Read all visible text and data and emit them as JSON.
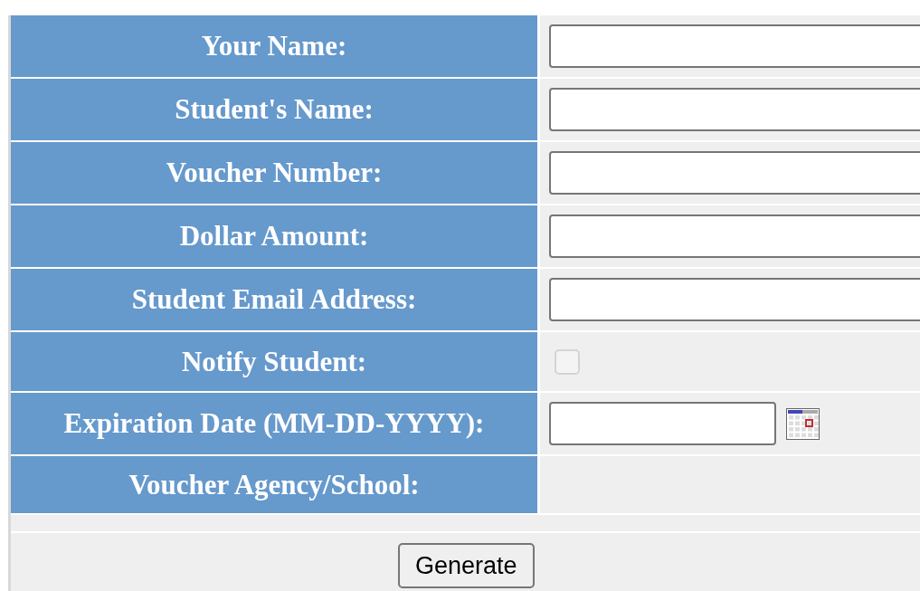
{
  "fields": [
    {
      "label": "Your Name:",
      "kind": "text"
    },
    {
      "label": "Student's Name:",
      "kind": "text"
    },
    {
      "label": "Voucher Number:",
      "kind": "text"
    },
    {
      "label": "Dollar Amount:",
      "kind": "text"
    },
    {
      "label": "Student Email Address:",
      "kind": "text"
    },
    {
      "label": "Notify Student:",
      "kind": "checkbox",
      "checked": false,
      "disabled": true
    },
    {
      "label": "Expiration Date (MM-DD-YYYY):",
      "kind": "date"
    },
    {
      "label": "Voucher Agency/School:",
      "kind": "none"
    }
  ],
  "button": "Generate"
}
